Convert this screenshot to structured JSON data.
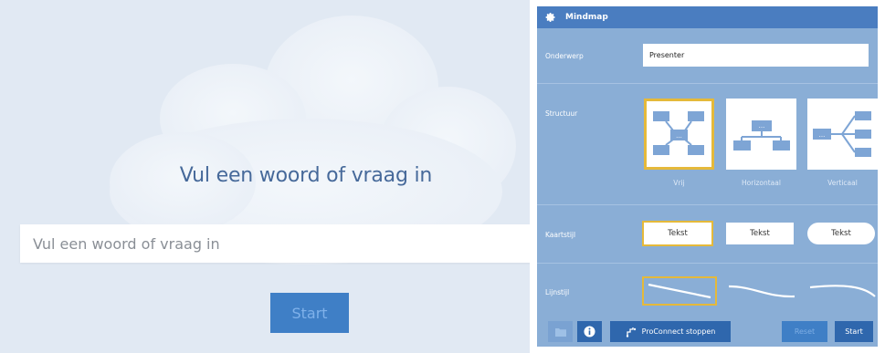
{
  "left_panel": {
    "title": "Vul een woord of vraag in",
    "input_placeholder": "Vul een woord of vraag in",
    "start_label": "Start"
  },
  "right_panel": {
    "header_title": "Mindmap",
    "header_icon": "gear-icon",
    "subject_label": "Onderwerp",
    "subject_value": "Presenter",
    "structure_label": "Structuur",
    "structure_options": [
      {
        "label": "Vrij",
        "selected": true
      },
      {
        "label": "Horizontaal",
        "selected": false
      },
      {
        "label": "Verticaal",
        "selected": false
      }
    ],
    "card_style_label": "Kaartstijl",
    "card_style_options": [
      {
        "label": "Tekst",
        "shape": "rectangle",
        "selected": true
      },
      {
        "label": "Tekst",
        "shape": "rectangle",
        "selected": false
      },
      {
        "label": "Tekst",
        "shape": "rounded",
        "selected": false
      }
    ],
    "line_style_label": "Lijnstijl",
    "line_style_options": [
      {
        "style": "straight",
        "selected": true
      },
      {
        "style": "curved",
        "selected": false
      },
      {
        "style": "arc",
        "selected": false
      }
    ],
    "bottom": {
      "folder_icon": "folder-icon",
      "info_icon": "info-icon",
      "proconnect_icon": "proconnect-icon",
      "proconnect_label": "ProConnect stoppen",
      "reset_label": "Reset",
      "start_label": "Start"
    }
  },
  "colors": {
    "accent": "#3f7fc6",
    "panel_bg": "#8aaed6",
    "header_bg": "#4a7dc0",
    "selected_outline": "#e5b93a",
    "left_bg": "#e1e9f3"
  }
}
